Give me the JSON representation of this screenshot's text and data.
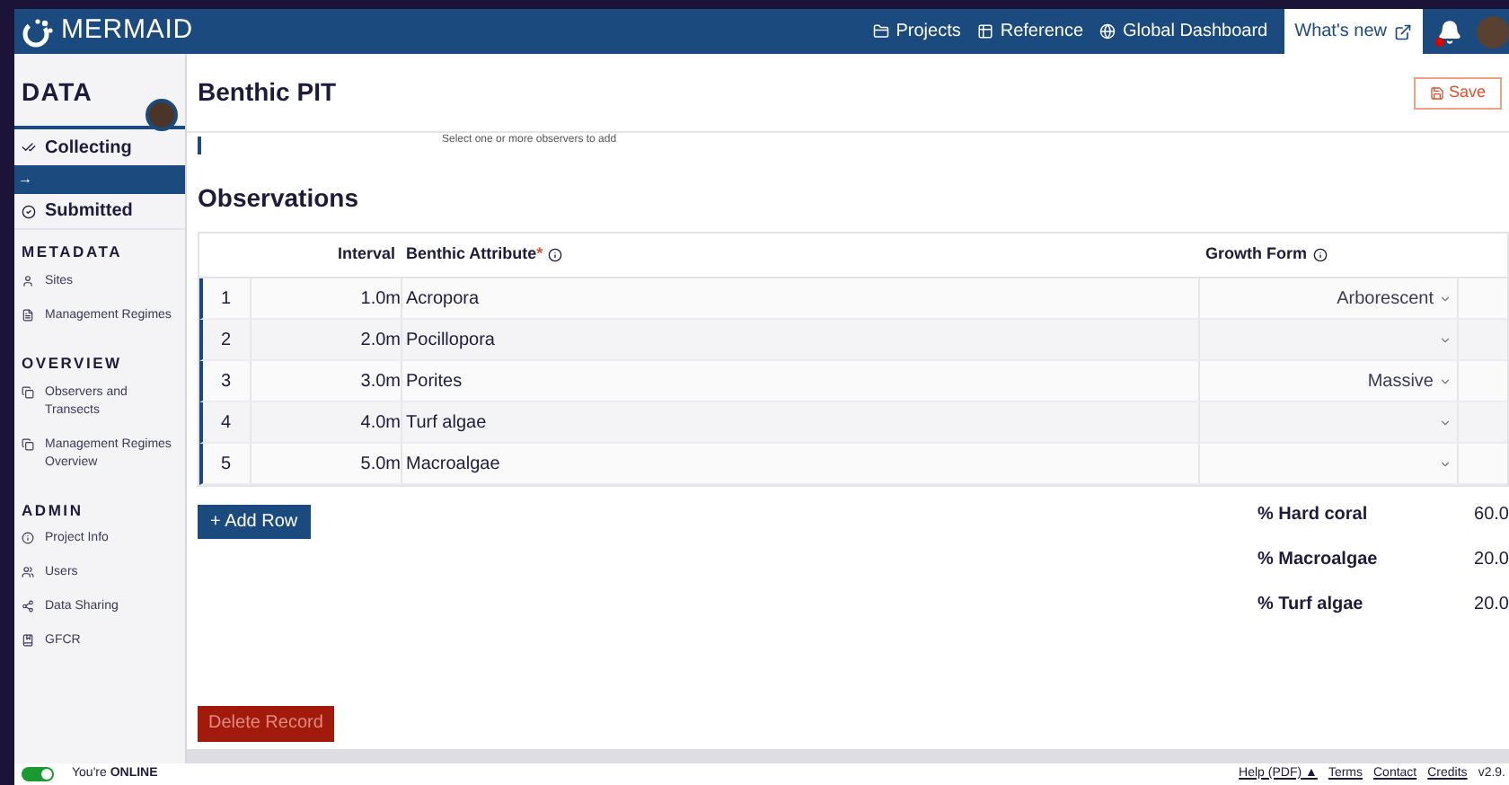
{
  "brand": "MERMAID",
  "nav": [
    {
      "label": "Projects"
    },
    {
      "label": "Reference"
    },
    {
      "label": "Global Dashboard"
    }
  ],
  "whats_new": "What's new",
  "notifications": {
    "unread": true
  },
  "sidebar": {
    "title": "DATA",
    "collapse_handle": "→",
    "top_items": [
      {
        "label": "Collecting",
        "selected": false
      },
      {
        "label": "Submitted",
        "selected": false
      }
    ],
    "sections": [
      {
        "title": "METADATA",
        "items": [
          {
            "label": "Sites"
          },
          {
            "label": "Management Regimes"
          }
        ]
      },
      {
        "title": "OVERVIEW",
        "items": [
          {
            "label": "Observers and Transects"
          },
          {
            "label": "Management Regimes Overview"
          }
        ]
      },
      {
        "title": "ADMIN",
        "items": [
          {
            "label": "Project Info"
          },
          {
            "label": "Users"
          },
          {
            "label": "Data Sharing"
          },
          {
            "label": "GFCR"
          }
        ]
      }
    ]
  },
  "page": {
    "title": "Benthic PIT",
    "save": "Save",
    "observers_hint": "Select one or more observers to add"
  },
  "observations": {
    "title": "Observations",
    "columns": [
      {
        "label": "Interval"
      },
      {
        "label": "Benthic Attribute",
        "required_mark": "*"
      },
      {
        "label": "Growth Form"
      }
    ],
    "rows": [
      {
        "number": "1",
        "interval": "1.0m",
        "attribute": "Acropora",
        "growth_form": "Arborescent"
      },
      {
        "number": "2",
        "interval": "2.0m",
        "attribute": "Pocillopora"
      },
      {
        "number": "3",
        "interval": "3.0m",
        "attribute": "Porites",
        "growth_form": "Massive"
      },
      {
        "number": "4",
        "interval": "4.0m",
        "attribute": "Turf algae"
      },
      {
        "number": "5",
        "interval": "5.0m",
        "attribute": "Macroalgae"
      }
    ],
    "add_row": "+ Add Row",
    "summary": [
      {
        "label": "% Hard coral",
        "value": "60.0"
      },
      {
        "label": "% Macroalgae",
        "value": "20.0"
      },
      {
        "label": "% Turf algae",
        "value": "20.0"
      }
    ]
  },
  "delete_record": "Delete Record",
  "footer": {
    "status_prefix": "You're",
    "status": "ONLINE",
    "online": true,
    "links": [
      "Help (PDF) ▲",
      "Terms",
      "Contact",
      "Credits"
    ],
    "version": "v2.9."
  }
}
